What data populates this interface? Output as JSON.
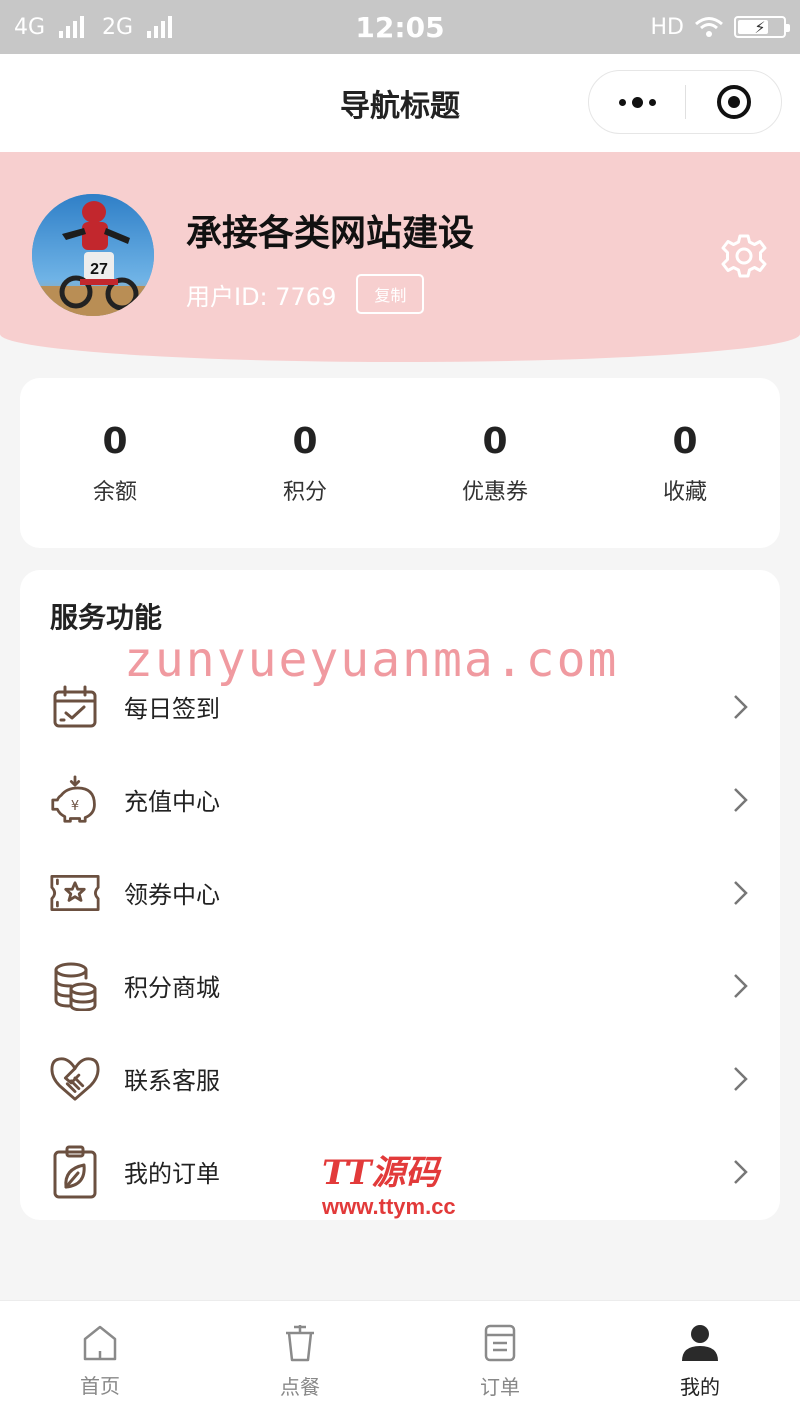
{
  "status_bar": {
    "network_1": "4G",
    "network_2": "2G",
    "time": "12:05",
    "hd": "HD"
  },
  "nav": {
    "title": "导航标题"
  },
  "profile": {
    "name": "承接各类网站建设",
    "user_id": "用户ID: 7769",
    "copy_label": "复制",
    "header_color": "#f7cfcf"
  },
  "stats": [
    {
      "value": "0",
      "label": "余额"
    },
    {
      "value": "0",
      "label": "积分"
    },
    {
      "value": "0",
      "label": "优惠券"
    },
    {
      "value": "0",
      "label": "收藏"
    }
  ],
  "services": {
    "title": "服务功能",
    "watermark": "zunyueyuanma.com",
    "items": [
      {
        "label": "每日签到",
        "icon": "calendar-check-icon"
      },
      {
        "label": "充值中心",
        "icon": "piggy-bank-icon"
      },
      {
        "label": "领券中心",
        "icon": "coupon-icon"
      },
      {
        "label": "积分商城",
        "icon": "coins-icon"
      },
      {
        "label": "联系客服",
        "icon": "heart-handshake-icon"
      },
      {
        "label": "我的订单",
        "icon": "clipboard-leaf-icon"
      }
    ],
    "brand_title": "TT源码",
    "brand_url": "www.ttym.cc",
    "icon_color": "#6b5040"
  },
  "tab_bar": {
    "tabs": [
      {
        "label": "首页",
        "icon": "home-icon"
      },
      {
        "label": "点餐",
        "icon": "cup-icon"
      },
      {
        "label": "订单",
        "icon": "order-icon"
      },
      {
        "label": "我的",
        "icon": "user-icon",
        "active": true
      }
    ]
  }
}
